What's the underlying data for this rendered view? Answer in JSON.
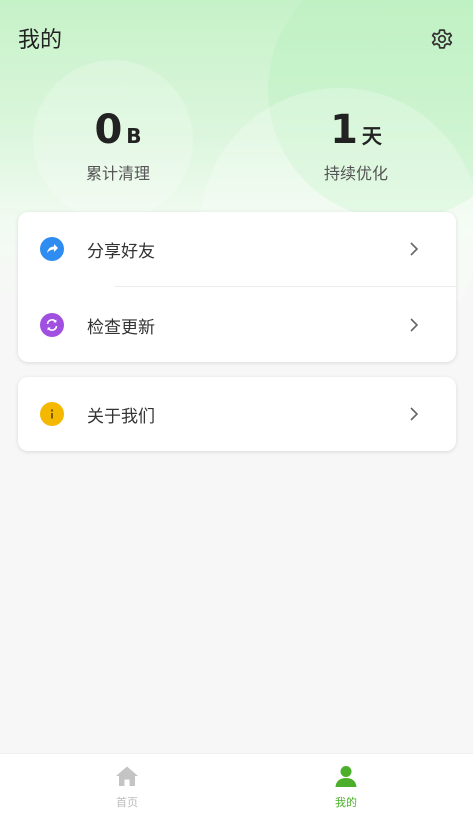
{
  "header": {
    "title": "我的"
  },
  "stats": [
    {
      "value": "0",
      "unit": "B",
      "label": "累计清理"
    },
    {
      "value": "1",
      "unit": "天",
      "label": "持续优化"
    }
  ],
  "menu": {
    "share_label": "分享好友",
    "update_label": "检查更新",
    "about_label": "关于我们"
  },
  "tabs": [
    {
      "label": "首页",
      "active": false
    },
    {
      "label": "我的",
      "active": true
    }
  ],
  "colors": {
    "accent": "#4caf2b",
    "share_icon": "#2f8cf0",
    "update_icon": "#a04fe0",
    "about_icon": "#f5b800"
  }
}
